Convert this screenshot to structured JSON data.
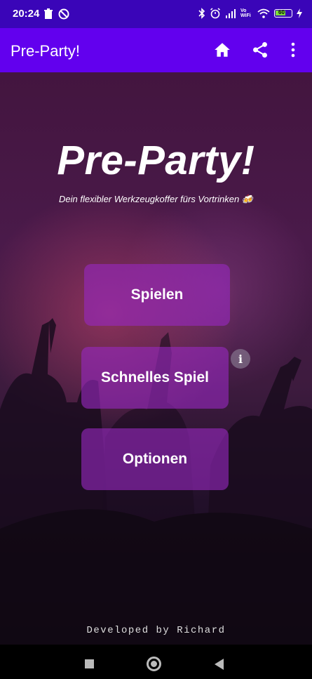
{
  "status_bar": {
    "time": "20:24",
    "network_label": "Vo WiFi",
    "battery_level": "60"
  },
  "app_bar": {
    "title": "Pre-Party!",
    "color": "#6200ee"
  },
  "hero": {
    "title": "Pre-Party!",
    "subtitle": "Dein flexibler Werkzeugkoffer fürs Vortrinken 🍻"
  },
  "menu": {
    "play_label": "Spielen",
    "quick_game_label": "Schnelles Spiel",
    "options_label": "Optionen",
    "info_label": "i"
  },
  "footer": {
    "credit": "Developed by Richard"
  },
  "icons": [
    "home-icon",
    "share-icon",
    "more-vert-icon",
    "info-icon"
  ]
}
